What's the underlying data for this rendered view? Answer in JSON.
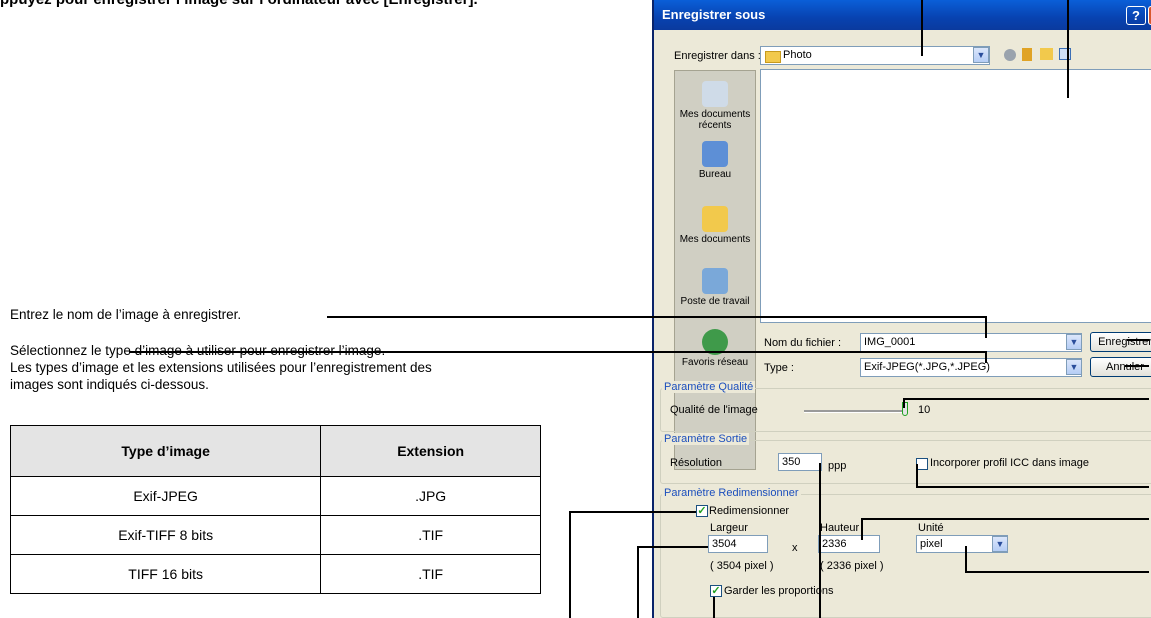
{
  "header_cut_text": "ppuyez pour enregistrer l’image sur l’ordinateur avec [Enregistrer].",
  "notes": {
    "filename": "Entrez le nom de l’image à enregistrer.",
    "type_line1": "Sélectionnez le type d’image à utiliser pour enregistrer l’image.",
    "type_line2": "Les types d’image et les extensions utilisées pour l’enregistrement des",
    "type_line3": "images sont indiqués ci-dessous."
  },
  "table": {
    "headers": [
      "Type d’image",
      "Extension"
    ],
    "rows": [
      [
        "Exif-JPEG",
        ".JPG"
      ],
      [
        "Exif-TIFF 8 bits",
        ".TIF"
      ],
      [
        "TIFF 16 bits",
        ".TIF"
      ]
    ]
  },
  "dialog": {
    "title": "Enregistrer sous",
    "help_btn": "?",
    "close_btn": "X",
    "save_in_label": "Enregistrer dans :",
    "save_in_value": "Photo",
    "places": [
      "Mes documents récents",
      "Bureau",
      "Mes documents",
      "Poste de travail",
      "Favoris réseau"
    ],
    "filename_label": "Nom du fichier :",
    "filename_value": "IMG_0001",
    "type_label": "Type :",
    "type_value": "Exif-JPEG(*.JPG,*.JPEG)",
    "save_button": "Enregistrer",
    "cancel_button": "Annuler",
    "quality": {
      "group": "Paramètre Qualité",
      "label": "Qualité de l'image",
      "value": "10"
    },
    "output": {
      "group": "Paramètre Sortie",
      "resolution_label": "Résolution",
      "resolution_value": "350",
      "resolution_unit": "ppp",
      "icc_label": "Incorporer profil ICC dans image"
    },
    "resize": {
      "group": "Paramètre Redimensionner",
      "resize_label": "Redimensionner",
      "width_label": "Largeur",
      "width_value": "3504",
      "width_px": "( 3504 pixel )",
      "times": "x",
      "height_label": "Hauteur",
      "height_value": "2336",
      "height_px": "( 2336 pixel )",
      "unit_label": "Unité",
      "unit_value": "pixel",
      "keep_label": "Garder les proportions"
    }
  },
  "colors": {
    "title_bar": "#0842b0",
    "dialog_bg": "#ece9d8",
    "group_label": "#1c4fbd",
    "table_header_bg": "#e4e4e4"
  }
}
